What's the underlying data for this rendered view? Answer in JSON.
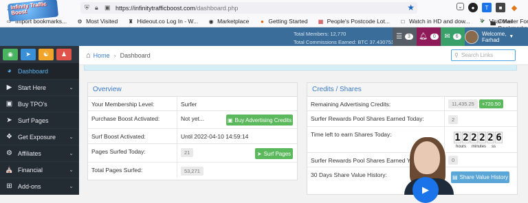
{
  "browser": {
    "url_host": "https://infinitytrafficboost.com",
    "url_path": "/dashboard.php",
    "bookmarks": [
      {
        "label": "Import bookmarks..."
      },
      {
        "label": "Most Visited"
      },
      {
        "label": "Hideout.co Log In - W..."
      },
      {
        "label": "Marketplace"
      },
      {
        "label": "Getting Started"
      },
      {
        "label": "People's Postcode Lot..."
      },
      {
        "label": "Watch in HD and dow..."
      },
      {
        "label": "Viral Mailer For You! F..."
      }
    ],
    "other_bookmarks": "Other Bookmarks"
  },
  "header": {
    "logo_text": "Infinity Traffic Boost",
    "total_members": "Total Members: 12,770",
    "total_commissions": "Total Commissions Earned: BTC 37.43075199",
    "stats": [
      {
        "icon": "server-icon",
        "count": "3",
        "color": "#555e66"
      },
      {
        "icon": "bell-icon",
        "count": "0",
        "color": "#8e1a5a"
      },
      {
        "icon": "envelope-icon",
        "count": "6",
        "color": "#3aa06a"
      }
    ],
    "welcome": "Welcome,",
    "username": "Farhad"
  },
  "sidebar": {
    "quick_buttons": [
      {
        "icon": "gamepad-icon",
        "color": "#49b35f"
      },
      {
        "icon": "send-icon",
        "color": "#3a8fd6"
      },
      {
        "icon": "users-icon",
        "color": "#f0a42a"
      },
      {
        "icon": "user-icon",
        "color": "#e0534a"
      }
    ],
    "items": [
      {
        "label": "Dashboard",
        "icon": "dashboard-icon",
        "active": true
      },
      {
        "label": "Start Here",
        "icon": "play-icon"
      },
      {
        "label": "Buy TPO's",
        "icon": "cart-icon"
      },
      {
        "label": "Surf Pages",
        "icon": "send-icon"
      },
      {
        "label": "Get Exposure",
        "icon": "puzzle-icon"
      },
      {
        "label": "Affiliates",
        "icon": "gear-icon"
      },
      {
        "label": "Financial",
        "icon": "bank-icon"
      },
      {
        "label": "Add-ons",
        "icon": "plus-square-icon"
      }
    ]
  },
  "breadcrumb": {
    "home": "Home",
    "current": "Dashboard"
  },
  "search": {
    "placeholder": "Search Links"
  },
  "overview": {
    "title": "Overview",
    "rows": [
      {
        "label": "Your Membership Level:",
        "value": "Surfer"
      },
      {
        "label": "Purchase Boost Activated:",
        "value": "Not yet...",
        "button": "Buy Advertising Credits"
      },
      {
        "label": "Surf Boost Activated:",
        "value": "Until 2022-04-10 14:59:14"
      },
      {
        "label": "Pages Surfed Today:",
        "value": "21",
        "button": "Surf Pages"
      },
      {
        "label": "Total Pages Surfed:",
        "value": "53,271"
      }
    ]
  },
  "credits": {
    "title": "Credits / Shares",
    "rows": [
      {
        "label": "Remaining Advertising Credits:",
        "value": "11,435.25",
        "delta": "+720.50"
      },
      {
        "label": "Surfer Rewards Pool Shares Earned Today:",
        "value": "2"
      },
      {
        "label": "Time left to earn Shares Today:",
        "counter": "122226",
        "counter_labels": [
          "hours",
          "minutes",
          "ss"
        ]
      },
      {
        "label": "Surfer Rewards Pool Shares Earned Yester",
        "value": "0"
      },
      {
        "label": "30 Days Share Value History:",
        "button": "Share Value History"
      }
    ]
  }
}
